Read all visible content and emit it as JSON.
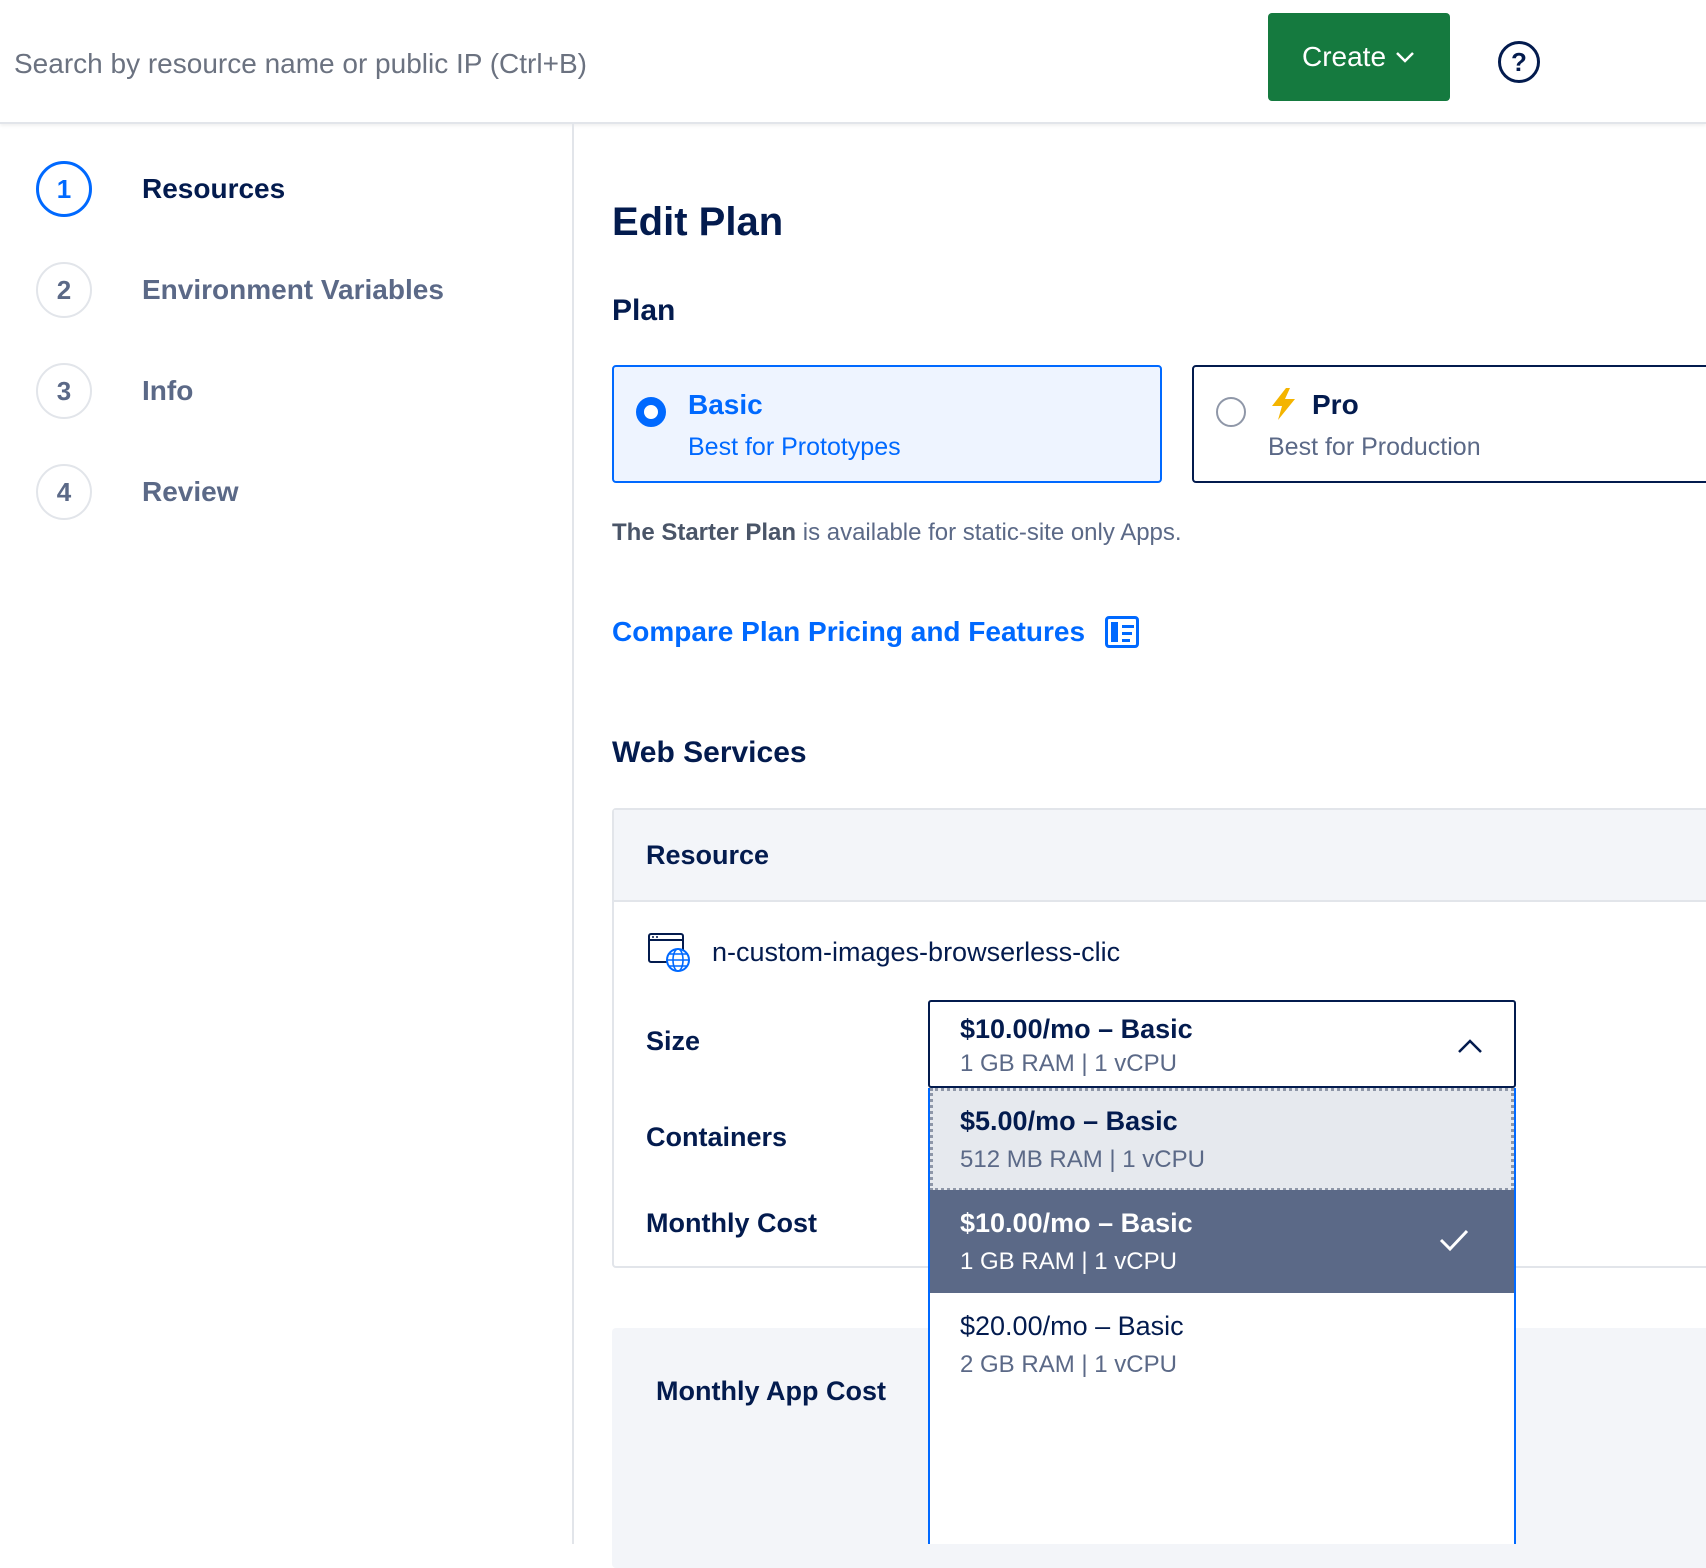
{
  "topbar": {
    "search_placeholder": "Search by resource name or public IP (Ctrl+B)",
    "create_label": "Create",
    "help_label": "?"
  },
  "steps": [
    {
      "num": "1",
      "label": "Resources",
      "active": true
    },
    {
      "num": "2",
      "label": "Environment Variables",
      "active": false
    },
    {
      "num": "3",
      "label": "Info",
      "active": false
    },
    {
      "num": "4",
      "label": "Review",
      "active": false
    }
  ],
  "main": {
    "title": "Edit Plan",
    "plan_heading": "Plan",
    "plans": [
      {
        "name": "Basic",
        "subtitle": "Best for Prototypes",
        "selected": true
      },
      {
        "name": "Pro",
        "subtitle": "Best for Production",
        "selected": false,
        "icon": "lightning-bolt-icon"
      }
    ],
    "note_bold": "The Starter Plan",
    "note_rest": " is available for static-site only Apps.",
    "compare_link": "Compare Plan Pricing and Features",
    "web_services_heading": "Web Services",
    "table": {
      "header": "Resource",
      "resource_name": "n-custom-images-browserless-clic",
      "size_label": "Size",
      "containers_label": "Containers",
      "monthly_cost_label": "Monthly Cost"
    },
    "monthly_app_cost_label": "Monthly App Cost"
  },
  "size_select": {
    "current": {
      "price": "$10.00/mo – Basic",
      "spec": "1 GB RAM | 1 vCPU"
    },
    "options": [
      {
        "price": "$5.00/mo – Basic",
        "spec": "512 MB RAM | 1 vCPU",
        "state": "focused"
      },
      {
        "price": "$10.00/mo – Basic",
        "spec": "1 GB RAM | 1 vCPU",
        "state": "selected"
      },
      {
        "price": "$20.00/mo – Basic",
        "spec": "2 GB RAM | 1 vCPU",
        "state": "normal"
      }
    ]
  },
  "colors": {
    "accent": "#0069ff",
    "create_button": "#157a3f",
    "text_primary": "#031b4e",
    "selected_option_bg": "#5b6987"
  }
}
